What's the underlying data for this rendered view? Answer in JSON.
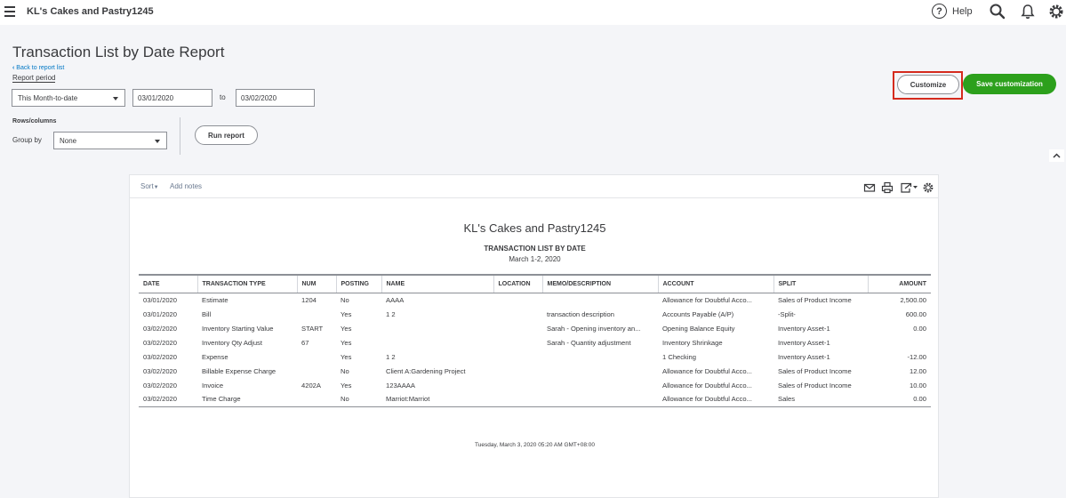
{
  "app": {
    "company_name": "KL's Cakes and Pastry1245",
    "help_label": "Help",
    "icons": [
      "menu-icon",
      "help-icon",
      "search-icon",
      "bell-icon",
      "gear-icon"
    ]
  },
  "header": {
    "title": "Transaction List by Date Report",
    "back_link": "Back to report list",
    "report_period_label": "Report period",
    "period_select": "This Month-to-date",
    "start_date": "03/01/2020",
    "to_label": "to",
    "end_date": "03/02/2020",
    "rows_columns_label": "Rows/columns",
    "group_by_label": "Group by",
    "group_by_select": "None",
    "run_report_label": "Run report",
    "customize_label": "Customize",
    "save_customization_label": "Save customization"
  },
  "report": {
    "sort_label": "Sort",
    "add_notes_label": "Add notes",
    "company": "KL's Cakes and Pastry1245",
    "title": "TRANSACTION LIST BY DATE",
    "date_range": "March 1-2, 2020",
    "columns": [
      "DATE",
      "TRANSACTION TYPE",
      "NUM",
      "POSTING",
      "NAME",
      "LOCATION",
      "MEMO/DESCRIPTION",
      "ACCOUNT",
      "SPLIT",
      "AMOUNT"
    ],
    "rows": [
      [
        "03/01/2020",
        "Estimate",
        "1204",
        "No",
        "AAAA",
        "",
        "",
        "Allowance for Doubtful Acco...",
        "Sales of Product Income",
        "2,500.00"
      ],
      [
        "03/01/2020",
        "Bill",
        "",
        "Yes",
        "1 2",
        "",
        "transaction description",
        "Accounts Payable (A/P)",
        "-Split-",
        "600.00"
      ],
      [
        "03/02/2020",
        "Inventory Starting Value",
        "START",
        "Yes",
        "",
        "",
        "Sarah - Opening inventory an...",
        "Opening Balance Equity",
        "Inventory Asset-1",
        "0.00"
      ],
      [
        "03/02/2020",
        "Inventory Qty Adjust",
        "67",
        "Yes",
        "",
        "",
        "Sarah - Quantity adjustment",
        "Inventory Shrinkage",
        "Inventory Asset-1",
        ""
      ],
      [
        "03/02/2020",
        "Expense",
        "",
        "Yes",
        "1 2",
        "",
        "",
        "1 Checking",
        "Inventory Asset-1",
        "-12.00"
      ],
      [
        "03/02/2020",
        "Billable Expense Charge",
        "",
        "No",
        "Client A:Gardening Project",
        "",
        "",
        "Allowance for Doubtful Acco...",
        "Sales of Product Income",
        "12.00"
      ],
      [
        "03/02/2020",
        "Invoice",
        "4202A",
        "Yes",
        "123AAAA",
        "",
        "",
        "Allowance for Doubtful Acco...",
        "Sales of Product Income",
        "10.00"
      ],
      [
        "03/02/2020",
        "Time Charge",
        "",
        "No",
        "Marriot:Marriot",
        "",
        "",
        "Allowance for Doubtful Acco...",
        "Sales",
        "0.00"
      ]
    ],
    "footer_timestamp": "Tuesday, March 3, 2020  05:20 AM GMT+08:00"
  },
  "colors": {
    "accent_blue": "#0077c5",
    "green_button": "#2ca01c",
    "highlight_red": "#d52b1e"
  }
}
